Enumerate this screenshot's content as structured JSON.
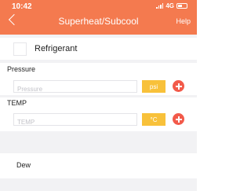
{
  "status_bar": {
    "time": "10:42",
    "network": "4G"
  },
  "nav": {
    "title": "Superheat/Subcool",
    "help_label": "Help"
  },
  "refrigerant": {
    "label": "Refrigerant"
  },
  "pressure": {
    "label": "Pressure",
    "placeholder": "Pressure",
    "value": "",
    "unit": "psi"
  },
  "temp": {
    "label": "TEMP",
    "placeholder": "TEMP",
    "value": "",
    "unit": "°C"
  },
  "mode": {
    "label": "Dew"
  },
  "colors": {
    "header": "#f47a4f",
    "unit_button": "#f8c13a",
    "add_button": "#f25a4a",
    "band": "#f2f2f4"
  }
}
